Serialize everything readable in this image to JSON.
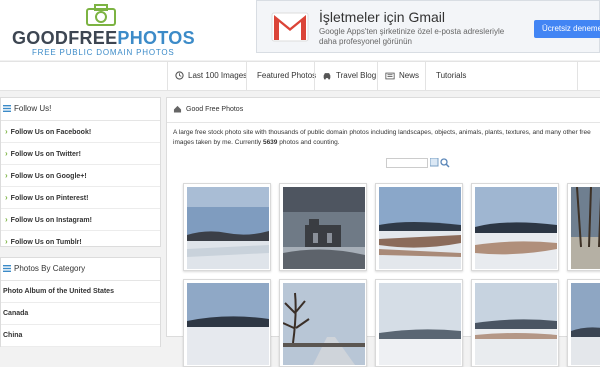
{
  "logo": {
    "part1": "GOODFREE",
    "part2": "PHOTOS",
    "tagline": "FREE PUBLIC DOMAIN PHOTOS"
  },
  "ad": {
    "title": "İşletmeler için Gmail",
    "body": "Google Apps'ten şirketinize özel e-posta adresleriyle daha profesyonel görünün",
    "button": "Ücretsiz deneme"
  },
  "nav": [
    {
      "label": "Last 100 Images",
      "icon": "clock-icon"
    },
    {
      "label": "Featured Photos",
      "icon": ""
    },
    {
      "label": "Travel Blog",
      "icon": "car-icon"
    },
    {
      "label": "News",
      "icon": "newspaper-icon"
    },
    {
      "label": "Tutorials",
      "icon": ""
    }
  ],
  "follow": {
    "heading": "Follow Us!",
    "items": [
      "Follow Us on Facebook!",
      "Follow Us on Twitter!",
      "Follow Us on Google+!",
      "Follow Us on Pinterest!",
      "Follow Us on Instagram!",
      "Follow Us on Tumblr!"
    ]
  },
  "categories": {
    "heading": "Photos By Category",
    "items": [
      "Photo Album of the United States",
      "Canada",
      "China"
    ]
  },
  "main": {
    "breadcrumb": "Good Free Photos",
    "desc_pre": "A large free stock photo site with thousands of public domain photos including landscapes, objects, animals, plants, textures, and many other free images taken by me. Currently ",
    "count": "5639",
    "desc_post": " photos and counting."
  },
  "colors": {
    "accent": "#3c8bc8",
    "chevron": "#7cb342",
    "ad_button": "#4285f4"
  }
}
